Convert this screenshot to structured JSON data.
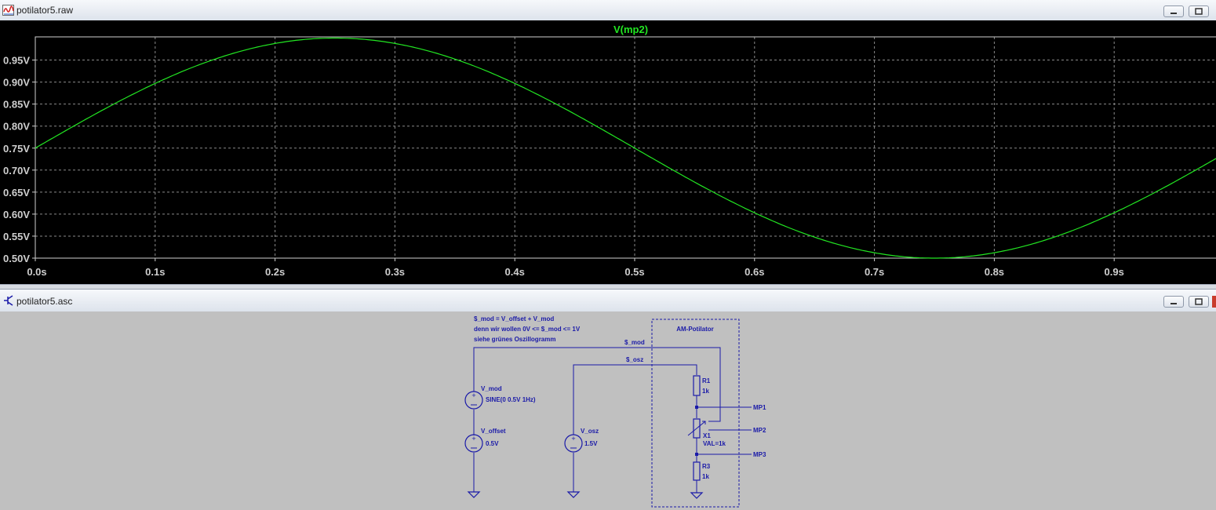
{
  "plot_window": {
    "title": "potilator5.raw",
    "trace_label": "V(mp2)"
  },
  "schematic_window": {
    "title": "potilator5.asc",
    "comment_lines": [
      "$_mod = V_offset + V_mod",
      "denn wir wollen 0V <= $_mod <= 1V",
      "siehe grünes Oszillogramm"
    ],
    "box_label": "AM-Potilator",
    "net_labels": {
      "mod": "$_mod",
      "osz": "$_osz"
    },
    "components": {
      "v_mod": {
        "name": "V_mod",
        "value": "SINE(0 0.5V 1Hz)"
      },
      "v_offset": {
        "name": "V_offset",
        "value": "0.5V"
      },
      "v_osz": {
        "name": "V_osz",
        "value": "1.5V"
      },
      "r1": {
        "name": "R1",
        "value": "1k"
      },
      "x1": {
        "name": "X1",
        "value": "VAL=1k"
      },
      "r3": {
        "name": "R3",
        "value": "1k"
      }
    },
    "probes": [
      "MP1",
      "MP2",
      "MP3"
    ]
  },
  "colors": {
    "trace": "#22e622",
    "wire": "#1a1aa8",
    "plot_bg": "#000000",
    "schematic_bg": "#c0c0c0"
  },
  "icons": {
    "plot_window": "waveform-icon",
    "schematic_window": "transistor-icon"
  },
  "chart_data": {
    "type": "line",
    "title": "V(mp2)",
    "xlabel": "",
    "ylabel": "",
    "xlim": [
      0,
      0.99
    ],
    "ylim": [
      0.5,
      1.0
    ],
    "x_ticks": [
      0.0,
      0.1,
      0.2,
      0.3,
      0.4,
      0.5,
      0.6,
      0.7,
      0.8,
      0.9
    ],
    "x_tick_labels": [
      "0.0s",
      "0.1s",
      "0.2s",
      "0.3s",
      "0.4s",
      "0.5s",
      "0.6s",
      "0.7s",
      "0.8s",
      "0.9s"
    ],
    "y_ticks": [
      0.95,
      0.9,
      0.85,
      0.8,
      0.75,
      0.7,
      0.65,
      0.6,
      0.55,
      0.5
    ],
    "y_tick_labels": [
      "0.95V",
      "0.90V",
      "0.85V",
      "0.80V",
      "0.75V",
      "0.70V",
      "0.65V",
      "0.60V",
      "0.55V",
      "0.50V"
    ],
    "grid": true,
    "series": [
      {
        "name": "V(mp2)",
        "x": [
          0.0,
          0.05,
          0.1,
          0.15,
          0.2,
          0.25,
          0.3,
          0.35,
          0.4,
          0.45,
          0.5,
          0.55,
          0.6,
          0.65,
          0.7,
          0.75,
          0.8,
          0.85,
          0.9,
          0.95,
          0.99
        ],
        "y": [
          0.75,
          0.827,
          0.897,
          0.952,
          0.988,
          1.0,
          0.988,
          0.952,
          0.897,
          0.827,
          0.75,
          0.673,
          0.603,
          0.548,
          0.512,
          0.5,
          0.512,
          0.548,
          0.603,
          0.673,
          0.734
        ]
      }
    ]
  }
}
